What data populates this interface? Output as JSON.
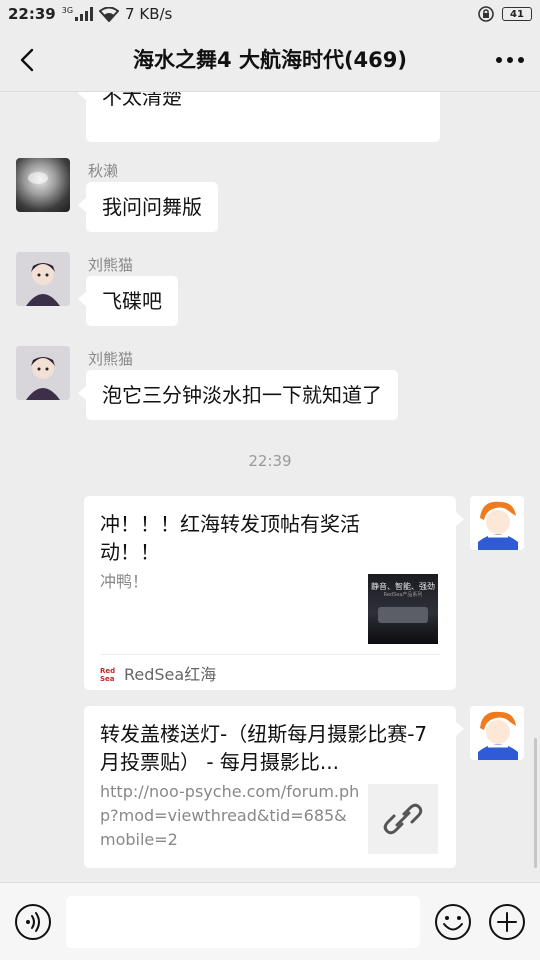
{
  "status_bar": {
    "time": "22:39",
    "network_type": "3G",
    "speed": "7 KB/s",
    "battery": "41"
  },
  "header": {
    "title": "海水之舞4 大航海时代(469)"
  },
  "messages": [
    {
      "text": "不太清楚"
    },
    {
      "sender": "秋濑",
      "text": "我问问舞版"
    },
    {
      "sender": "刘熊猫",
      "text": "飞碟吧"
    },
    {
      "sender": "刘熊猫",
      "text": "泡它三分钟淡水扣一下就知道了"
    }
  ],
  "timestamp": "22:39",
  "cards": [
    {
      "title": "冲！！！红海转发顶帖有奖活动！！",
      "desc": "冲鸭！",
      "thumb_text": "静音、智能、强劲",
      "thumb_subtext": "RedSea产品系列",
      "source_icon": "Red Sea",
      "source": "RedSea红海"
    },
    {
      "title": "转发盖楼送灯-（纽斯每月摄影比赛-7月投票贴） - 每月摄影比...",
      "url": "http://noo-psyche.com/forum.php?mod=viewthread&tid=685&mobile=2",
      "link_icon": "link-icon"
    }
  ],
  "input": {
    "placeholder": ""
  },
  "colors": {
    "background": "#ededed",
    "bubble": "#ffffff",
    "secondary_text": "#888888"
  }
}
